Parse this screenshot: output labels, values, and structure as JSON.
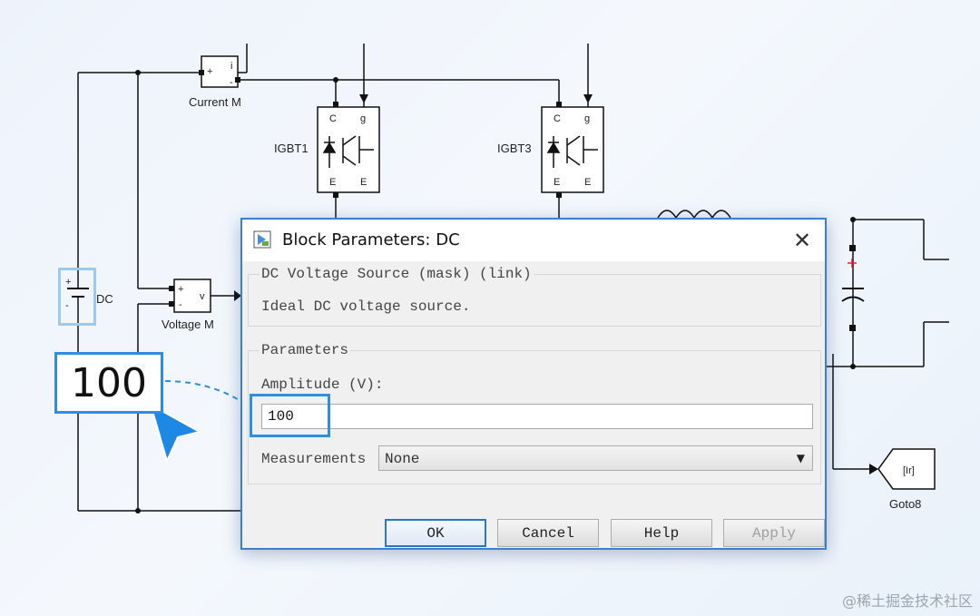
{
  "diagram": {
    "labels": {
      "current_m": "Current M",
      "voltage_m": "Voltage M",
      "igbt1": "IGBT1",
      "igbt3": "IGBT3",
      "dc": "DC",
      "goto8": "Goto8",
      "goto_tag": "[Ir]"
    },
    "pins": {
      "plus": "+",
      "minus": "-",
      "i": "i",
      "v": "v",
      "c": "C",
      "g": "g",
      "e": "E"
    }
  },
  "dialog": {
    "title": "Block Parameters: DC",
    "close_glyph": "✕",
    "mask_group": {
      "legend": "DC Voltage Source (mask) (link)",
      "description": "Ideal DC voltage source."
    },
    "params_group": {
      "legend": "Parameters",
      "amplitude_label": "Amplitude (V):",
      "amplitude_value": "100",
      "measurements_label": "Measurements",
      "measurements_value": "None"
    },
    "buttons": {
      "ok": "OK",
      "cancel": "Cancel",
      "help": "Help",
      "apply": "Apply"
    }
  },
  "callout": {
    "value": "100"
  },
  "watermark": "@稀土掘金技术社区",
  "colors": {
    "accent": "#2e8fe0",
    "dialog_border": "#3c7fd0"
  }
}
